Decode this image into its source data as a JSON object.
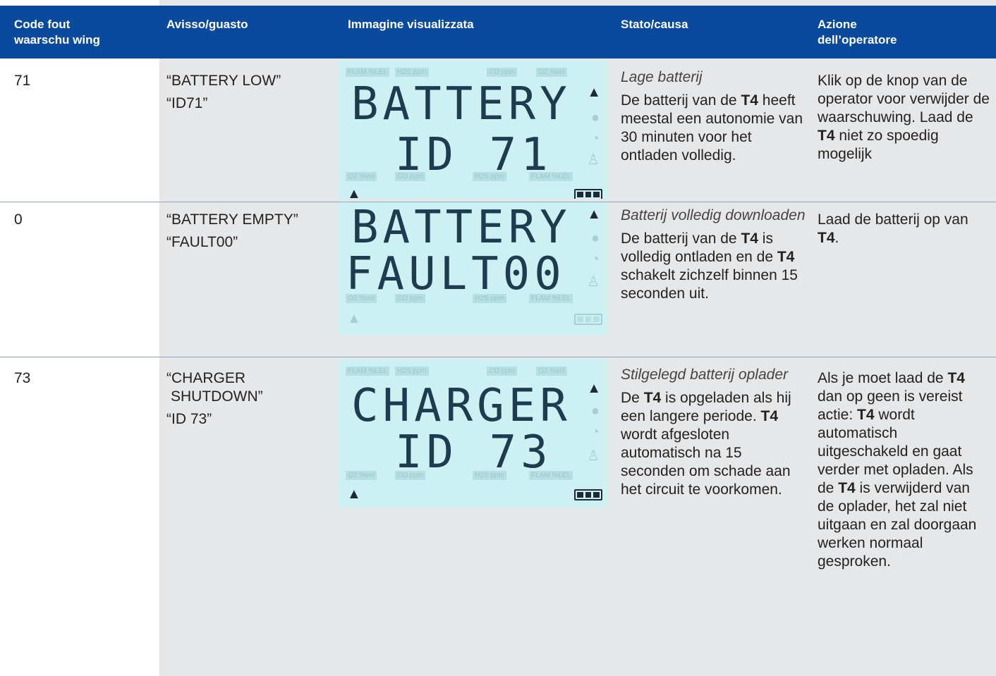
{
  "headers": {
    "code": [
      "Code fout",
      "waarschu wing"
    ],
    "warning": "Avisso/guasto",
    "image": "Immagine visualizzata",
    "status": "Stato/causa",
    "action": [
      "Azione",
      "dell’operatore"
    ]
  },
  "rows": [
    {
      "code": "71",
      "msg1": "“BATTERY LOW”",
      "msg2": "“ID71”",
      "lcd_line1": "BATTERY",
      "lcd_line2": "ID 71",
      "status_title": "Lage batterij",
      "status_a": "De batterij van de ",
      "status_b": "T4",
      "status_c": " heeft meestal een autonomie van 30 minuten voor het ontladen volledig.",
      "action_a": "Klik op de knop van de operator voor verwijder de waarschuwing. Laad de ",
      "action_b": "T4",
      "action_c": " niet zo spoedig mogelijk"
    },
    {
      "code": "0",
      "msg1": "“BATTERY EMPTY”",
      "msg2": "“FAULT00”",
      "lcd_line1": "BATTERY",
      "lcd_line2": "FAULT00",
      "status_title": "Batterij volledig downloaden",
      "status_a": "De batterij van de ",
      "status_b": "T4",
      "status_c": " is volledig ontladen en de ",
      "status_d": "T4",
      "status_e": " schakelt zichzelf binnen 15 seconden uit.",
      "action_a": "Laad de batterij op van ",
      "action_b": "T4",
      "action_c": "."
    },
    {
      "code": "73",
      "msg1": "“CHARGER",
      "msg1b": "SHUTDOWN”",
      "msg2": "“ID 73”",
      "lcd_line1": "CHARGER",
      "lcd_line2": "ID 73",
      "status_title": "Stilgelegd batterij oplader",
      "status_a": "De ",
      "status_b": "T4",
      "status_c": " is opgeladen als hij een langere periode. ",
      "status_d": "T4",
      "status_e": " wordt afgesloten automatisch na 15 seconden om schade aan het circuit te voorkomen.",
      "action_a": "Als je moet laad de ",
      "action_b": "T4",
      "action_c": " dan op geen is vereist actie: ",
      "action_d": "T4",
      "action_e": " wordt automatisch uitgeschakeld en gaat verder met opladen. Als de ",
      "action_f": "T4",
      "action_g": " is verwijderd van de oplader, het zal niet uitgaan en zal doorgaan werken normaal gesproken."
    }
  ],
  "lcd_ghost_labels": {
    "top": [
      "FLAM %LEL",
      "H2S ppm",
      "CO ppm",
      "O2 %vol"
    ],
    "bottom": [
      "O2 %vol",
      "CO ppm",
      "H2S ppm",
      "FLAM %LEL"
    ]
  },
  "icons": {
    "alarm": "warning-triangle-icon",
    "home": "home-icon",
    "battery": "battery-icon"
  },
  "colors": {
    "header_bg": "#0a4a9c",
    "lcd_bg": "#cdf0f2",
    "lcd_ink": "#1e3b4f"
  }
}
